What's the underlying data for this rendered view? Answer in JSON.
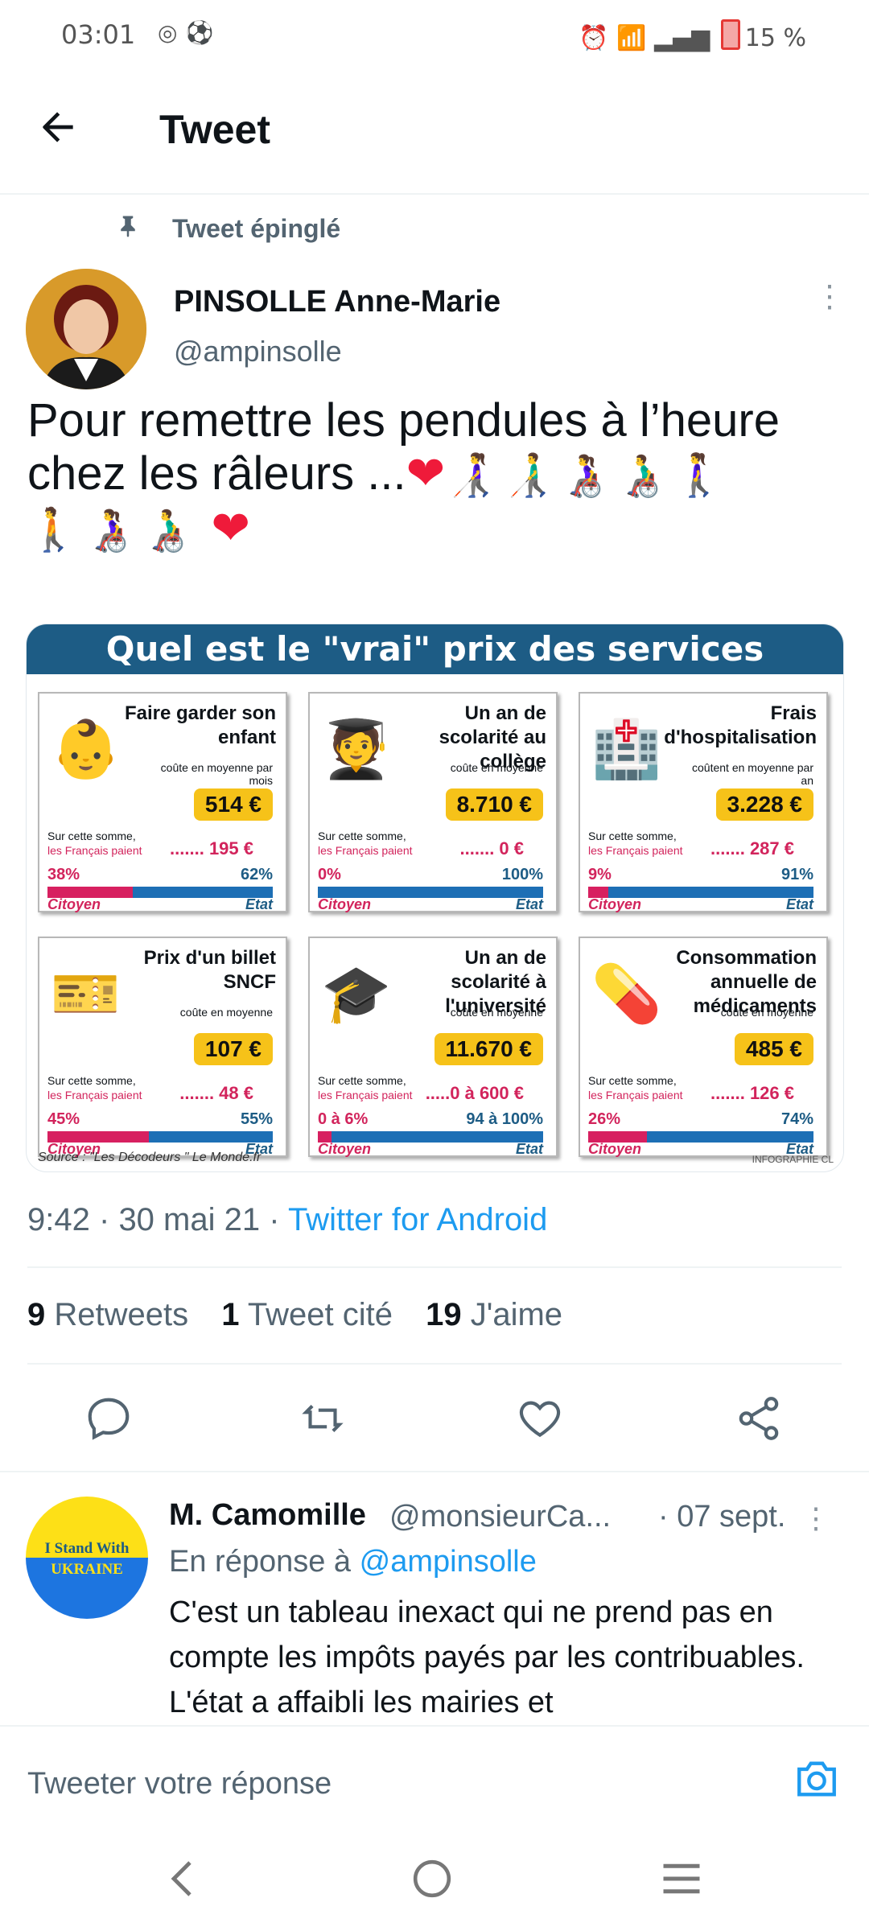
{
  "status_bar": {
    "time": "03:01",
    "battery": "15 %",
    "icons": [
      "instagram-icon",
      "soccer-icon",
      "alarm-icon",
      "wifi-icon",
      "signal-icon",
      "battery-icon"
    ]
  },
  "header": {
    "title": "Tweet"
  },
  "pinned_label": "Tweet épinglé",
  "tweet": {
    "author_name": "PINSOLLE Anne-Marie",
    "author_handle": "@ampinsolle",
    "text_line1": "Pour remettre les pendules à l’heure",
    "text_line2": "chez les râleurs ...",
    "emoji_line1": "👩‍🦯👨‍🦯👩‍🦽👨‍🦽🚶‍♀️",
    "emoji_line2": "🚶👩‍🦽👨‍🦽",
    "time": "9:42",
    "date": "30 mai 21",
    "source": "Twitter for Android",
    "separator": "·"
  },
  "infographic": {
    "title": "Quel est le \"vrai\" prix des services financés par l'Etat ?",
    "source": "Source : \"Les Décodeurs \" Le Monde.fr",
    "credit": "INFOGRAPHIE CL",
    "sur_line1": "Sur cette somme,",
    "sur_line2": "les Français paient",
    "label_citoyen": "Citoyen",
    "label_etat": "Etat",
    "cards": [
      {
        "title": "Faire garder son enfant",
        "cost_label": "coûte en moyenne par mois",
        "price": "514 €",
        "paid": "....... 195 €",
        "citoyen_pct": "38%",
        "etat_pct": "62%",
        "citoyen_share": 0.38,
        "icon": "👶"
      },
      {
        "title": "Un an de scolarité au collège",
        "cost_label": "coûte en moyenne",
        "price": "8.710 €",
        "paid": "....... 0 €",
        "citoyen_pct": "0%",
        "etat_pct": "100%",
        "citoyen_share": 0.0,
        "icon": "🧑‍🎓"
      },
      {
        "title": "Frais d'hospitalisation",
        "cost_label": "coûtent en moyenne par an",
        "price": "3.228 €",
        "paid": "....... 287 €",
        "citoyen_pct": "9%",
        "etat_pct": "91%",
        "citoyen_share": 0.09,
        "icon": "🏥"
      },
      {
        "title": "Prix d'un billet SNCF",
        "cost_label": "coûte en moyenne",
        "price": "107 €",
        "paid": "....... 48 €",
        "citoyen_pct": "45%",
        "etat_pct": "55%",
        "citoyen_share": 0.45,
        "icon": "🎫"
      },
      {
        "title": "Un an de scolarité à l'université",
        "cost_label": "coûte en moyenne",
        "price": "11.670 €",
        "paid": ".....0 à 600 €",
        "citoyen_pct": "0 à 6%",
        "etat_pct": "94 à 100%",
        "citoyen_share": 0.06,
        "icon": "🎓"
      },
      {
        "title": "Consommation annuelle de médicaments",
        "cost_label": "coûte en moyenne",
        "price": "485 €",
        "paid": "....... 126 €",
        "citoyen_pct": "26%",
        "etat_pct": "74%",
        "citoyen_share": 0.26,
        "icon": "💊"
      }
    ]
  },
  "stats": {
    "retweets_count": "9",
    "retweets_label": "Retweets",
    "quotes_count": "1",
    "quotes_label": "Tweet cité",
    "likes_count": "19",
    "likes_label": "J'aime"
  },
  "reply": {
    "name": "M. Camomille",
    "handle": "@monsieurCa...",
    "date": "· 07 sept.",
    "replying_prefix": "En réponse à",
    "replying_to": "@ampinsolle",
    "text": "C'est un tableau inexact qui ne prend pas en compte les impôts payés par les contribuables. L'état a affaibli les mairies et",
    "avatar_line1": "I Stand With",
    "avatar_line2": "UKRAINE"
  },
  "compose": {
    "placeholder": "Tweeter votre réponse"
  },
  "colors": {
    "accent": "#1d9bf0",
    "like": "#ef1a3a",
    "etat_blue": "#1d5c85",
    "citoyen_pink": "#d72060",
    "price_yellow": "#f6c219"
  }
}
